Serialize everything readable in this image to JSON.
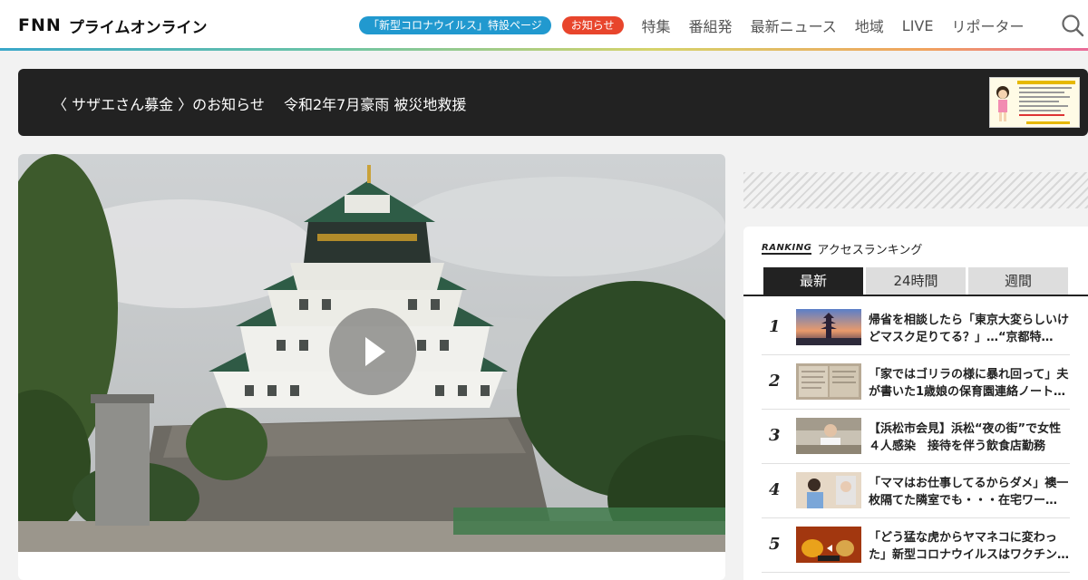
{
  "header": {
    "logo_fnn": "FNN",
    "logo_text": "プライムオンライン",
    "pill_corona": "「新型コロナウイルス」特設ページ",
    "pill_news": "お知らせ",
    "nav": [
      "特集",
      "番組発",
      "最新ニュース",
      "地域",
      "LIVE",
      "リポーター"
    ]
  },
  "banner": {
    "text": "〈 サザエさん募金 〉のお知らせ　 令和2年7月豪雨 被災地救援"
  },
  "ranking": {
    "logo": "RANKING",
    "title": "アクセスランキング",
    "tabs": [
      "最新",
      "24時間",
      "週間"
    ],
    "active_tab": 0,
    "items": [
      {
        "rank": "1",
        "title": "帰省を相談したら「東京大変らしいけどマスク足りてる？」…“京都特…"
      },
      {
        "rank": "2",
        "title": "「家ではゴリラの様に暴れ回って」夫が書いた1歳娘の保育園連絡ノート…"
      },
      {
        "rank": "3",
        "title": "【浜松市会見】浜松“夜の街”で女性４人感染　接待を伴う飲食店勤務"
      },
      {
        "rank": "4",
        "title": "「ママはお仕事してるからダメ」襖一枚隔てた隣室でも・・・在宅ワー…"
      },
      {
        "rank": "5",
        "title": "「どう猛な虎からヤマネコに変わった」新型コロナウイルスはワクチン…"
      }
    ]
  },
  "colors": {
    "accent_blue": "#2199cf",
    "accent_red": "#e8452c",
    "dark": "#222222"
  }
}
